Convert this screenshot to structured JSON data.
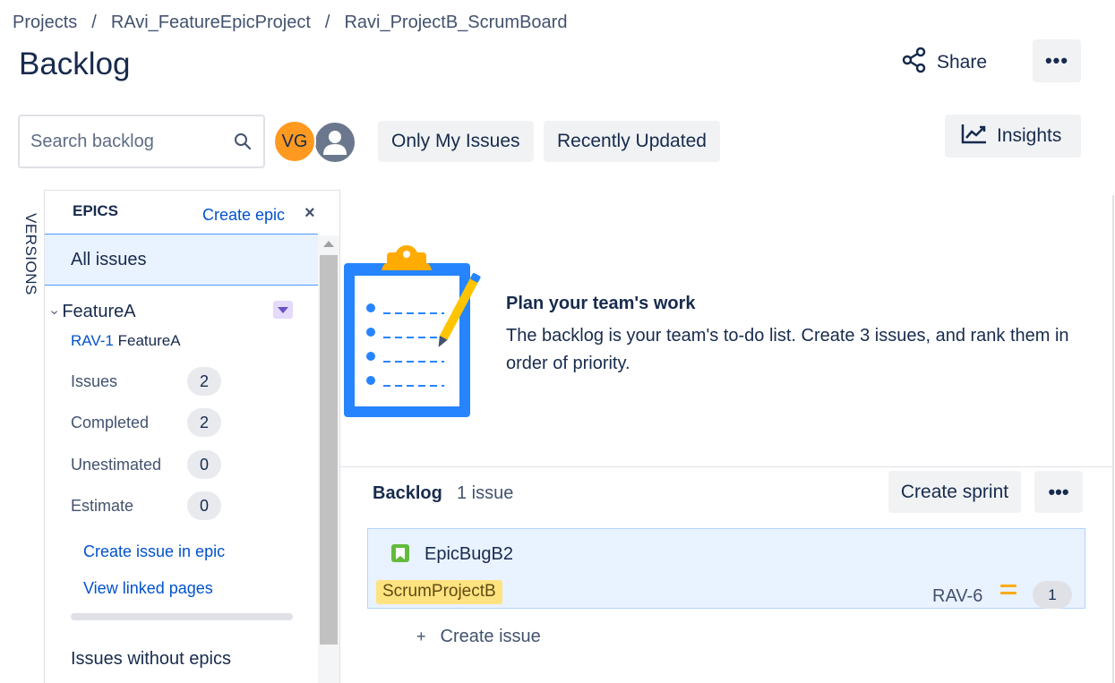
{
  "breadcrumb": {
    "items": [
      "Projects",
      "RAvi_FeatureEpicProject",
      "Ravi_ProjectB_ScrumBoard"
    ],
    "separator": "/"
  },
  "page": {
    "title": "Backlog"
  },
  "header": {
    "share_label": "Share",
    "more_label": "•••"
  },
  "toolbar": {
    "search_placeholder": "Search backlog",
    "avatar_initials": "VG",
    "filters": [
      "Only My Issues",
      "Recently Updated"
    ],
    "insights_label": "Insights"
  },
  "sidebar": {
    "versions_tab": "VERSIONS",
    "epics_title": "EPICS",
    "create_epic": "Create epic",
    "close": "×",
    "all_issues": "All issues",
    "epic": {
      "name": "FeatureA",
      "key": "RAV-1",
      "key_name": "FeatureA",
      "stats": [
        {
          "label": "Issues",
          "value": "2"
        },
        {
          "label": "Completed",
          "value": "2"
        },
        {
          "label": "Unestimated",
          "value": "0"
        },
        {
          "label": "Estimate",
          "value": "0"
        }
      ],
      "links": [
        "Create issue in epic",
        "View linked pages"
      ]
    },
    "issues_without_epics": "Issues without epics"
  },
  "empty_state": {
    "title": "Plan your team's work",
    "description": "The backlog is your team's to-do list. Create 3 issues, and rank them in order of priority."
  },
  "backlog": {
    "title": "Backlog",
    "count": "1 issue",
    "create_sprint": "Create sprint",
    "more_label": "•••",
    "issues": [
      {
        "summary": "EpicBugB2",
        "epic_label": "ScrumProjectB",
        "key": "RAV-6",
        "estimate": "1",
        "type_icon": "story-icon",
        "priority_icon": "medium-priority-icon"
      }
    ],
    "create_issue_label": "Create issue",
    "create_issue_plus": "+"
  },
  "colors": {
    "link": "#0052cc",
    "selected_bg": "#e9f2ff",
    "avatar_vg": "#ff991f",
    "epic_label_bg": "#ffe380",
    "story_green": "#63ba3c",
    "priority_medium": "#ffab00",
    "clipboard_blue": "#2684ff"
  }
}
